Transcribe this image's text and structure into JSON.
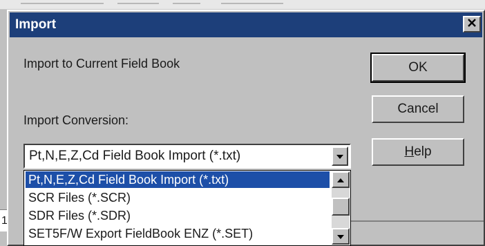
{
  "window": {
    "title": "Import",
    "close_icon": "close-icon"
  },
  "labels": {
    "import_target": "Import to Current Field Book",
    "conversion": "Import Conversion:"
  },
  "buttons": {
    "ok": "OK",
    "cancel": "Cancel",
    "help_mnemonic": "H",
    "help_rest": "elp"
  },
  "combo": {
    "selected_value": "Pt,N,E,Z,Cd Field Book Import (*.txt)",
    "arrow_icon": "chevron-down-icon"
  },
  "dropdown": {
    "items": [
      "Pt,N,E,Z,Cd Field Book Import (*.txt)",
      "SCR Files (*.SCR)",
      "SDR Files (*.SDR)",
      "SET5F/W Export FieldBook ENZ (*.SET)"
    ],
    "selected_index": 0
  },
  "background": {
    "row_number": "1."
  }
}
